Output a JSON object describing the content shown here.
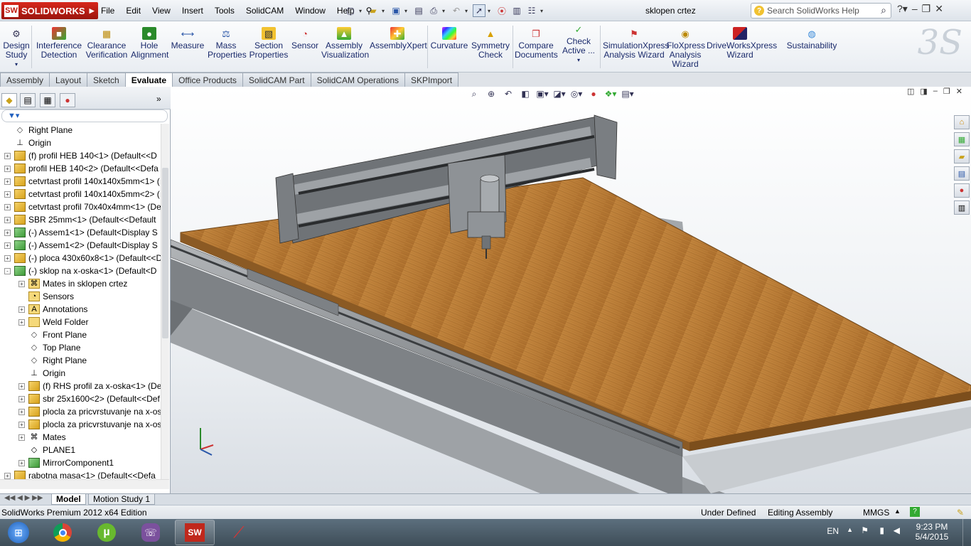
{
  "app": {
    "logo": "SOLIDWORKS",
    "doc_title": "sklopen crtez",
    "search_placeholder": "Search SolidWorks Help"
  },
  "menu": [
    "File",
    "Edit",
    "View",
    "Insert",
    "Tools",
    "SolidCAM",
    "Window",
    "Help"
  ],
  "commands": [
    {
      "l1": "Design",
      "l2": "Study"
    },
    {
      "l1": "Interference",
      "l2": "Detection"
    },
    {
      "l1": "Clearance",
      "l2": "Verification"
    },
    {
      "l1": "Hole",
      "l2": "Alignment"
    },
    {
      "l1": "Measure",
      "l2": ""
    },
    {
      "l1": "Mass",
      "l2": "Properties"
    },
    {
      "l1": "Section",
      "l2": "Properties"
    },
    {
      "l1": "Sensor",
      "l2": ""
    },
    {
      "l1": "Assembly",
      "l2": "Visualization"
    },
    {
      "l1": "AssemblyXpert",
      "l2": ""
    },
    {
      "l1": "Curvature",
      "l2": ""
    },
    {
      "l1": "Symmetry",
      "l2": "Check"
    },
    {
      "l1": "Compare",
      "l2": "Documents"
    },
    {
      "l1": "Check",
      "l2": "Active ..."
    },
    {
      "l1": "SimulationXpress",
      "l2": "Analysis Wizard"
    },
    {
      "l1": "FloXpress",
      "l2": "Analysis",
      "l3": "Wizard"
    },
    {
      "l1": "DriveWorksXpress",
      "l2": "Wizard"
    },
    {
      "l1": "Sustainability",
      "l2": ""
    }
  ],
  "tabs": [
    "Assembly",
    "Layout",
    "Sketch",
    "Evaluate",
    "Office Products",
    "SolidCAM Part",
    "SolidCAM Operations",
    "SKPImport"
  ],
  "active_tab": "Evaluate",
  "tree": [
    {
      "label": "Right Plane",
      "icon": "plane",
      "level": 0,
      "expand": ""
    },
    {
      "label": "Origin",
      "icon": "origin",
      "level": 0,
      "expand": ""
    },
    {
      "label": "(f) profil HEB 140<1> (Default<<D",
      "icon": "part",
      "level": 0,
      "expand": "+"
    },
    {
      "label": "profil HEB 140<2> (Default<<Defa",
      "icon": "part",
      "level": 0,
      "expand": "+"
    },
    {
      "label": "cetvrtast profil 140x140x5mm<1> (",
      "icon": "part",
      "level": 0,
      "expand": "+"
    },
    {
      "label": "cetvrtast profil 140x140x5mm<2> (",
      "icon": "part",
      "level": 0,
      "expand": "+"
    },
    {
      "label": "cetvrtast profil 70x40x4mm<1> (De",
      "icon": "part",
      "level": 0,
      "expand": "+"
    },
    {
      "label": "SBR 25mm<1> (Default<<Default",
      "icon": "part",
      "level": 0,
      "expand": "+"
    },
    {
      "label": "(-) Assem1<1> (Default<Display S",
      "icon": "asm",
      "level": 0,
      "expand": "+"
    },
    {
      "label": "(-) Assem1<2> (Default<Display S",
      "icon": "asm",
      "level": 0,
      "expand": "+"
    },
    {
      "label": "(-) ploca 430x60x8<1> (Default<<D",
      "icon": "part",
      "level": 0,
      "expand": "+"
    },
    {
      "label": "(-) sklop na x-oska<1> (Default<D",
      "icon": "asm",
      "level": 0,
      "expand": "-"
    },
    {
      "label": "Mates in sklopen crtez",
      "icon": "mates",
      "level": 1,
      "expand": "+"
    },
    {
      "label": "Sensors",
      "icon": "sensor",
      "level": 1,
      "expand": ""
    },
    {
      "label": "Annotations",
      "icon": "annot",
      "level": 1,
      "expand": "+"
    },
    {
      "label": "Weld Folder",
      "icon": "folder",
      "level": 1,
      "expand": "+"
    },
    {
      "label": "Front Plane",
      "icon": "plane",
      "level": 1,
      "expand": ""
    },
    {
      "label": "Top Plane",
      "icon": "plane",
      "level": 1,
      "expand": ""
    },
    {
      "label": "Right Plane",
      "icon": "plane",
      "level": 1,
      "expand": ""
    },
    {
      "label": "Origin",
      "icon": "origin",
      "level": 1,
      "expand": ""
    },
    {
      "label": "(f) RHS profil za x-oska<1> (De",
      "icon": "part",
      "level": 1,
      "expand": "+"
    },
    {
      "label": "sbr 25x1600<2> (Default<<Def",
      "icon": "part",
      "level": 1,
      "expand": "+"
    },
    {
      "label": "plocla za pricvrstuvanje na x-os",
      "icon": "part",
      "level": 1,
      "expand": "+"
    },
    {
      "label": "plocla za pricvrstuvanje na x-os",
      "icon": "part",
      "level": 1,
      "expand": "+"
    },
    {
      "label": "Mates",
      "icon": "matesfolder",
      "level": 1,
      "expand": "+"
    },
    {
      "label": "PLANE1",
      "icon": "plane1",
      "level": 1,
      "expand": ""
    },
    {
      "label": "MirrorComponent1",
      "icon": "mirror",
      "level": 1,
      "expand": "+"
    },
    {
      "label": "rabotna masa<1> (Default<<Defa",
      "icon": "part",
      "level": 0,
      "expand": "+"
    }
  ],
  "model_tabs": [
    "Model",
    "Motion Study 1"
  ],
  "status": {
    "edition": "SolidWorks Premium 2012 x64 Edition",
    "defined": "Under Defined",
    "mode": "Editing Assembly",
    "units": "MMGS"
  },
  "taskbar": {
    "lang": "EN",
    "time": "9:23 PM",
    "date": "5/4/2015"
  },
  "colors": {
    "wood": "#b87a34",
    "steel": "#8a8e92",
    "accent": "#1f5fbf"
  }
}
